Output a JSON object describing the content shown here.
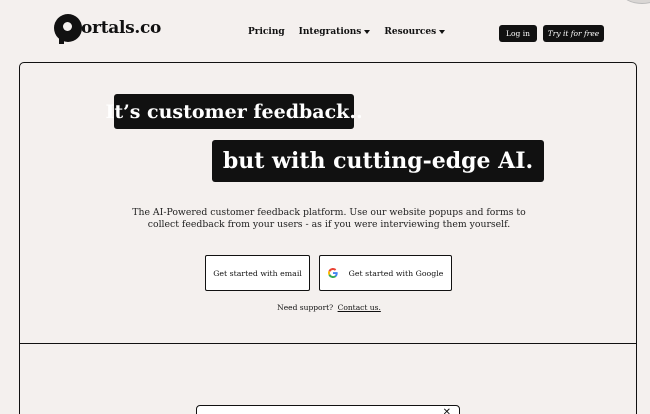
{
  "nav": {
    "logo_text": "ortals.co",
    "links": [
      {
        "label": "Pricing",
        "dropdown": false
      },
      {
        "label": "Integrations",
        "dropdown": true
      },
      {
        "label": "Resources",
        "dropdown": true
      }
    ],
    "login_label": "Log in",
    "try_label": "Try it for free"
  },
  "hero": {
    "headline_1": "It’s customer feedback..",
    "headline_2": "but with cutting-edge AI.",
    "subtitle": "The AI-Powered customer feedback platform. Use our website popups and forms to collect feedback from your users - as if you were interviewing them yourself.",
    "cta_email": "Get started with email",
    "cta_google": "Get started with Google",
    "support_text": "Need support?",
    "support_link": "Contact us."
  },
  "popup": {
    "close_glyph": "✕"
  },
  "colors": {
    "background": "#f4f0ee",
    "ink": "#111111"
  }
}
